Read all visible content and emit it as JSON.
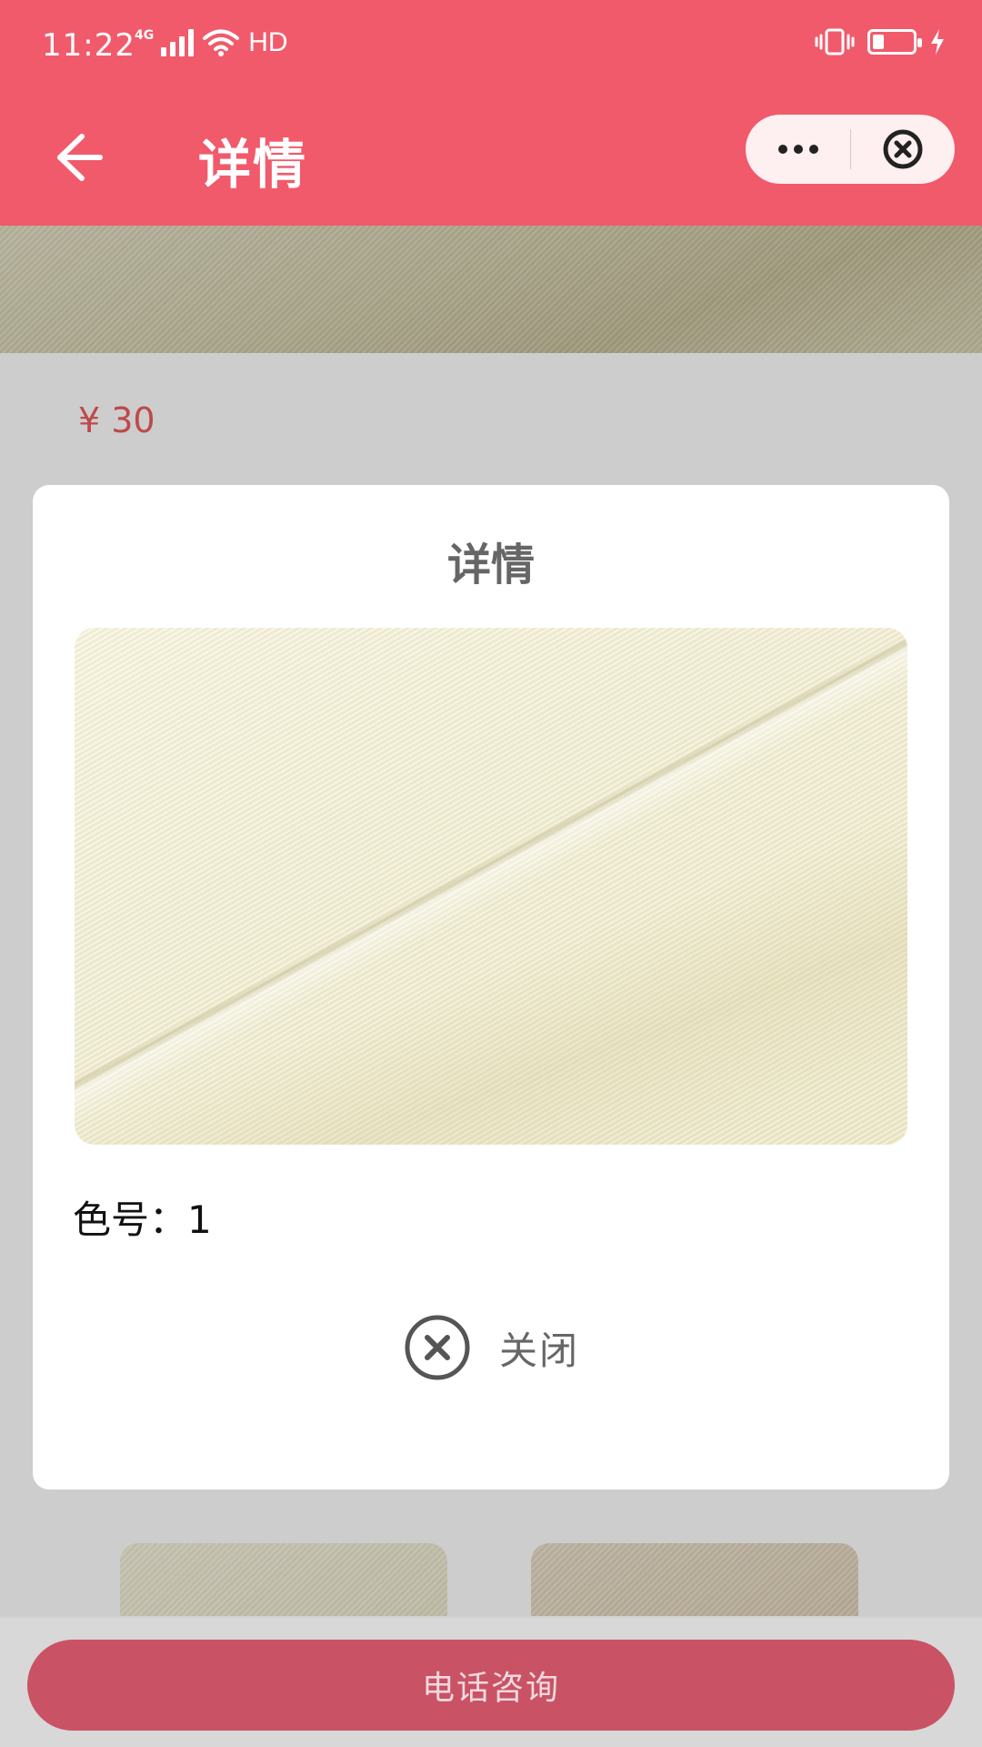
{
  "status_bar": {
    "time": "11:22",
    "network": "4G",
    "hd": "HD"
  },
  "header": {
    "title": "详情",
    "back_icon": "arrow-left-icon",
    "more_icon": "more-dots-icon",
    "close_icon": "close-circle-icon",
    "background": "#f15a6b"
  },
  "page": {
    "price": "¥ 30"
  },
  "modal": {
    "title": "详情",
    "color_label": "色号：1",
    "close_label": "关闭",
    "close_icon": "close-circle-icon"
  },
  "footer": {
    "call_label": "电话咨询",
    "button_color": "#c95365"
  }
}
